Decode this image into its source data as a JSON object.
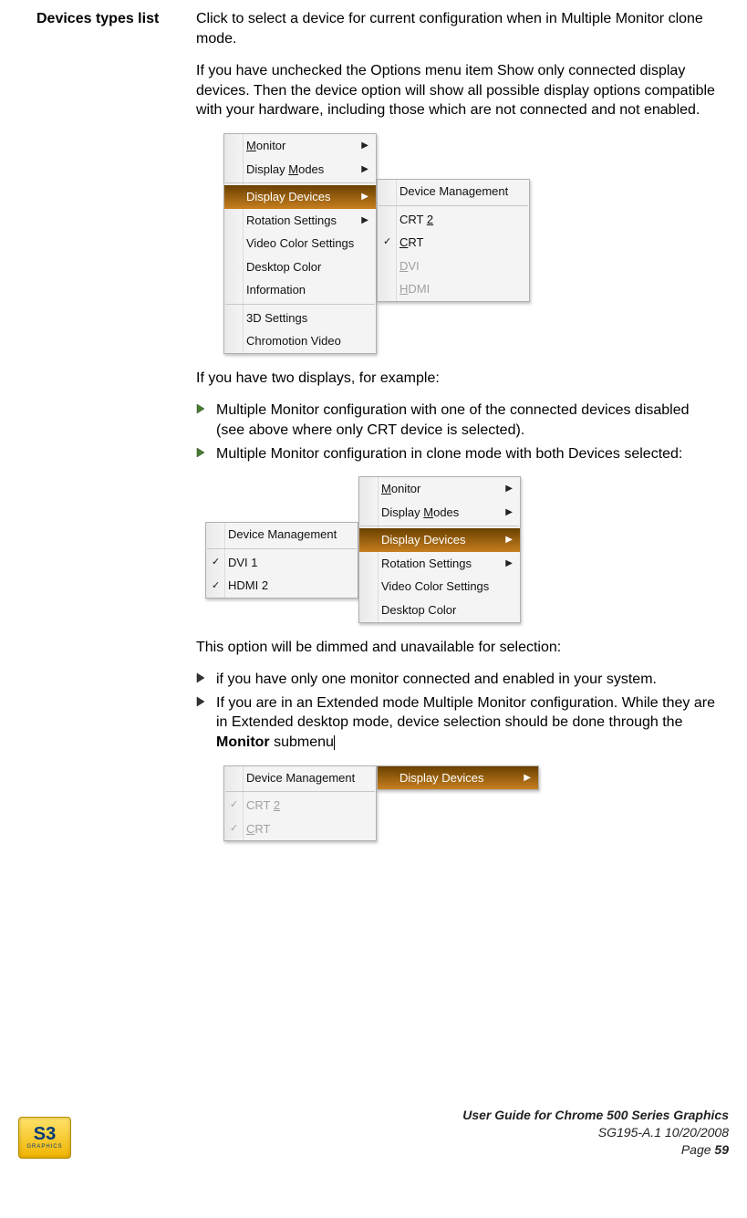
{
  "heading": "Devices types list",
  "para1": "Click to select a device for current configuration when in Multiple Monitor clone mode.",
  "para2": "If you have unchecked the Options menu item Show only connected display devices. Then the device option will show all possible display options compatible with your hardware, including those which are not connected and not enabled.",
  "para3": "If you have two displays, for  example:",
  "bul1a": "Multiple Monitor configuration with one of the connected devices disabled (see above where only CRT device is selected).",
  "bul1b": "Multiple Monitor configuration in clone mode with both Devices selected:",
  "para4": "This option will be dimmed and unavailable for selection:",
  "bul2a": "if you have only one monitor connected and enabled in your system.",
  "bul2b_a": "If you are in an Extended mode Multiple Monitor configuration. While they are in Extended desktop mode, device selection should be done through the ",
  "bul2b_b": "Monitor",
  "bul2b_c": " submenu",
  "fig1": {
    "left": {
      "items": [
        {
          "label": "Monitor",
          "arrow": true,
          "u": 0
        },
        {
          "label": "Display Modes",
          "arrow": true,
          "u": 8
        }
      ],
      "items2": [
        {
          "label": "Display Devices",
          "arrow": true,
          "highlight": true
        },
        {
          "label": "Rotation Settings",
          "arrow": true
        },
        {
          "label": "Video Color Settings"
        },
        {
          "label": "Desktop Color"
        },
        {
          "label": "Information"
        }
      ],
      "items3": [
        {
          "label": "3D Settings"
        },
        {
          "label": "Chromotion Video"
        }
      ]
    },
    "right": {
      "items": [
        {
          "label": "Device Management"
        }
      ],
      "items2": [
        {
          "label": "CRT 2",
          "u": 4
        },
        {
          "label": "CRT",
          "tick": true,
          "u": 0
        },
        {
          "label": "DVI",
          "disabled": true,
          "u": 0
        },
        {
          "label": "HDMI",
          "disabled": true,
          "u": 0
        }
      ]
    }
  },
  "fig2": {
    "left": {
      "items": [
        {
          "label": "Device Management"
        }
      ],
      "items2": [
        {
          "label": "DVI 1",
          "tick": true
        },
        {
          "label": "HDMI 2",
          "tick": true
        }
      ]
    },
    "right": {
      "items": [
        {
          "label": "Monitor",
          "arrow": true,
          "u": 0
        },
        {
          "label": "Display Modes",
          "arrow": true,
          "u": 8
        }
      ],
      "items2": [
        {
          "label": "Display Devices",
          "arrow": true,
          "highlight": true
        },
        {
          "label": "Rotation Settings",
          "arrow": true
        },
        {
          "label": "Video Color Settings"
        },
        {
          "label": "Desktop Color"
        }
      ]
    }
  },
  "fig3": {
    "left": {
      "items": [
        {
          "label": "Device Management"
        }
      ],
      "items2": [
        {
          "label": "CRT 2",
          "disabled": true,
          "tick": true,
          "u": 4
        },
        {
          "label": "CRT",
          "disabled": true,
          "tick": true,
          "u": 0
        }
      ]
    },
    "right": {
      "items": [
        {
          "label": "Display Devices",
          "arrow": true,
          "highlight": true
        }
      ]
    }
  },
  "footer": {
    "line1": "User Guide for Chrome 500 Series Graphics",
    "line2": "SG195-A.1   10/20/2008",
    "line3a": "Page ",
    "line3b": "59",
    "logo_main": "S3",
    "logo_sub": "GRAPHICS"
  }
}
